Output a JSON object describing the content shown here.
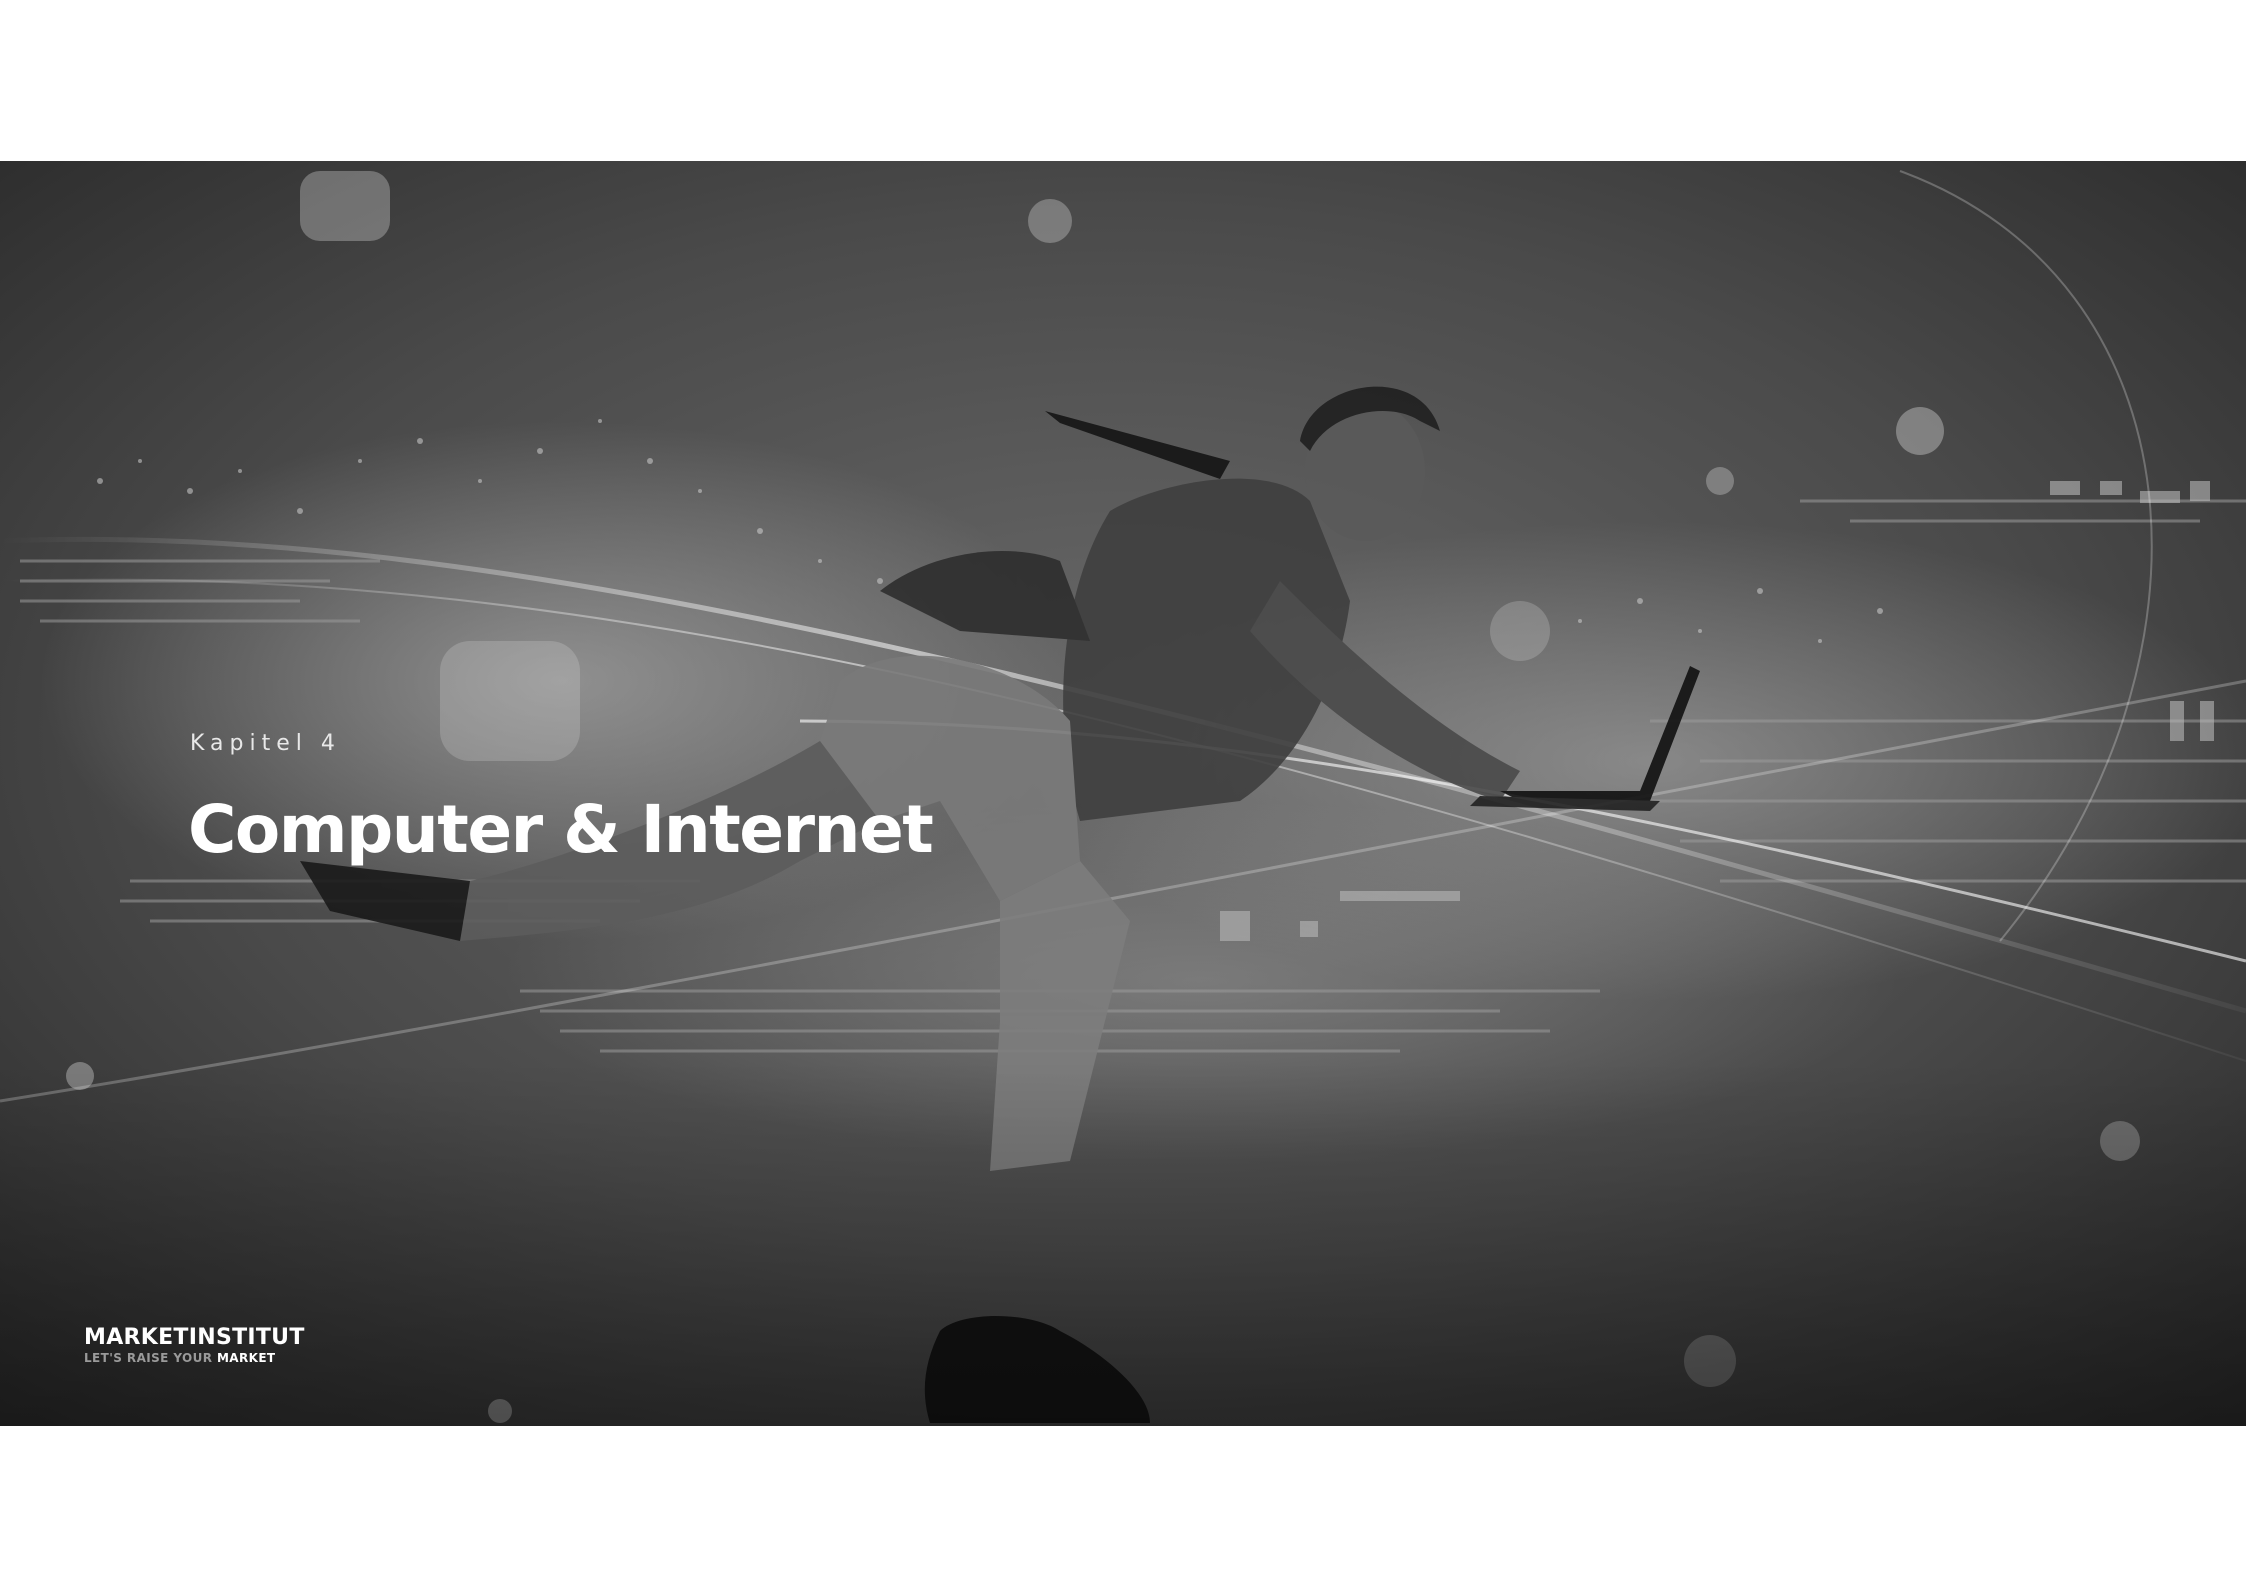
{
  "chapter": {
    "label": "Kapitel 4",
    "title": "Computer & Internet"
  },
  "brand": {
    "name": "MARKETINSTITUT",
    "tagline_prefix": "LET'S RAISE YOUR ",
    "tagline_emphasis": "MARKET"
  },
  "hero_image": {
    "description_icon": "running-businessman-with-laptop-photo",
    "tone": "grayscale"
  },
  "colors": {
    "page_background": "#ffffff",
    "hero_base": "#3a3a3a",
    "title_text": "#ffffff",
    "tagline_muted": "#9a9a9a"
  }
}
